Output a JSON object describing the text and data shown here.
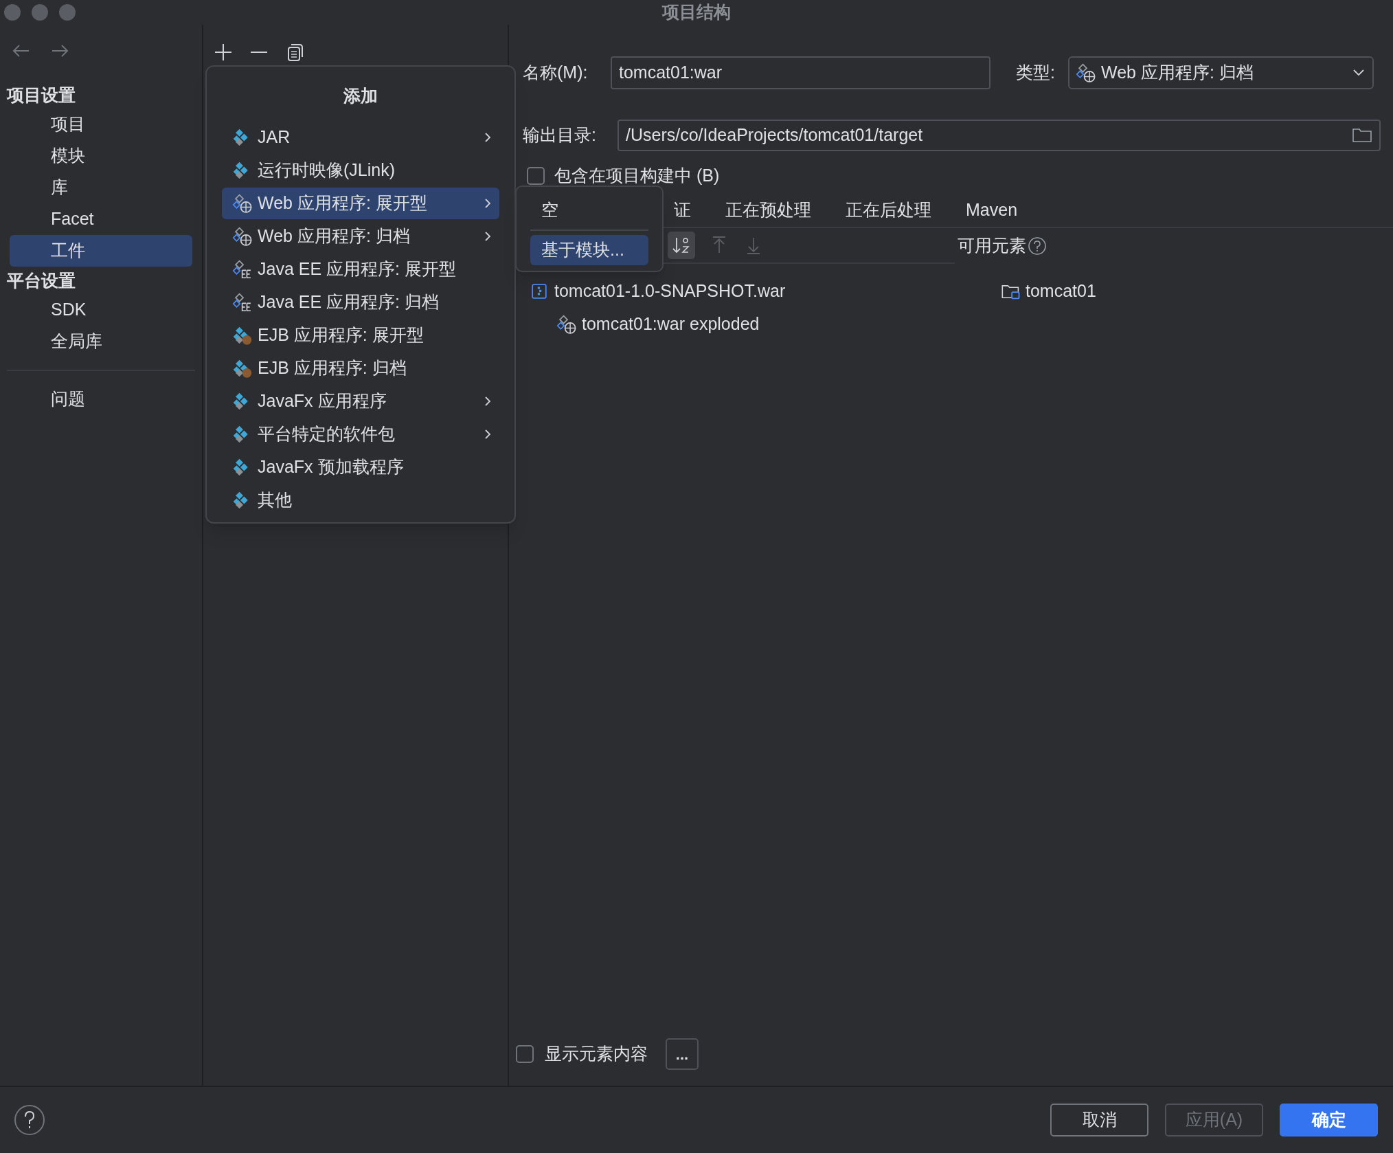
{
  "window": {
    "title": "项目结构"
  },
  "sidebar": {
    "sections": [
      {
        "title": "项目设置",
        "items": [
          {
            "label": "项目",
            "selected": false
          },
          {
            "label": "模块",
            "selected": false
          },
          {
            "label": "库",
            "selected": false
          },
          {
            "label": "Facet",
            "selected": false
          },
          {
            "label": "工件",
            "selected": true
          }
        ]
      },
      {
        "title": "平台设置",
        "items": [
          {
            "label": "SDK",
            "selected": false
          },
          {
            "label": "全局库",
            "selected": false
          }
        ]
      }
    ],
    "bottom_items": [
      {
        "label": "问题",
        "selected": false
      }
    ]
  },
  "add_menu": {
    "title": "添加",
    "items": [
      {
        "label": "JAR",
        "kind": "diamond",
        "submenu": true,
        "selected": false
      },
      {
        "label": "运行时映像(JLink)",
        "kind": "diamond",
        "submenu": false,
        "selected": false
      },
      {
        "label": "Web 应用程序: 展开型",
        "kind": "web",
        "submenu": true,
        "selected": true
      },
      {
        "label": "Web 应用程序: 归档",
        "kind": "web",
        "submenu": true,
        "selected": false
      },
      {
        "label": "Java EE 应用程序: 展开型",
        "kind": "javaee",
        "submenu": false,
        "selected": false
      },
      {
        "label": "Java EE 应用程序: 归档",
        "kind": "javaee",
        "submenu": false,
        "selected": false
      },
      {
        "label": "EJB 应用程序: 展开型",
        "kind": "ejb",
        "submenu": false,
        "selected": false
      },
      {
        "label": "EJB 应用程序: 归档",
        "kind": "ejb",
        "submenu": false,
        "selected": false
      },
      {
        "label": "JavaFx 应用程序",
        "kind": "diamond",
        "submenu": true,
        "selected": false
      },
      {
        "label": "平台特定的软件包",
        "kind": "diamond",
        "submenu": true,
        "selected": false
      },
      {
        "label": "JavaFx 预加载程序",
        "kind": "diamond",
        "submenu": false,
        "selected": false
      },
      {
        "label": "其他",
        "kind": "diamond",
        "submenu": false,
        "selected": false
      }
    ]
  },
  "submenu": {
    "items": [
      {
        "label": "空",
        "selected": false
      },
      {
        "label": "基于模块...",
        "selected": true
      }
    ]
  },
  "name_field": {
    "label": "名称(M):",
    "value": "tomcat01:war"
  },
  "type_dropdown": {
    "label": "类型:",
    "value": "Web 应用程序: 归档"
  },
  "output_field": {
    "label": "输出目录:",
    "value": "/Users/co/IdeaProjects/tomcat01/target"
  },
  "include_in_build": {
    "label": "包含在项目构建中 (B)",
    "checked": false
  },
  "tabs": [
    {
      "label": "证",
      "selected": false
    },
    {
      "label": "正在预处理",
      "selected": false
    },
    {
      "label": "正在后处理",
      "selected": false
    },
    {
      "label": "Maven",
      "selected": false
    }
  ],
  "output_tree": [
    {
      "label": "tomcat01-1.0-SNAPSHOT.war",
      "kind": "archive",
      "children": [
        {
          "label": "tomcat01:war exploded",
          "kind": "web"
        }
      ]
    }
  ],
  "available_elements": {
    "title": "可用元素",
    "items": [
      {
        "label": "tomcat01",
        "kind": "module"
      }
    ]
  },
  "show_content": {
    "label": "显示元素内容",
    "checked": false
  },
  "more_button": "...",
  "buttons": [
    {
      "label": "取消",
      "kind": "default",
      "disabled": false
    },
    {
      "label": "应用(A)",
      "kind": "default",
      "disabled": true
    },
    {
      "label": "确定",
      "kind": "primary",
      "disabled": false
    }
  ]
}
